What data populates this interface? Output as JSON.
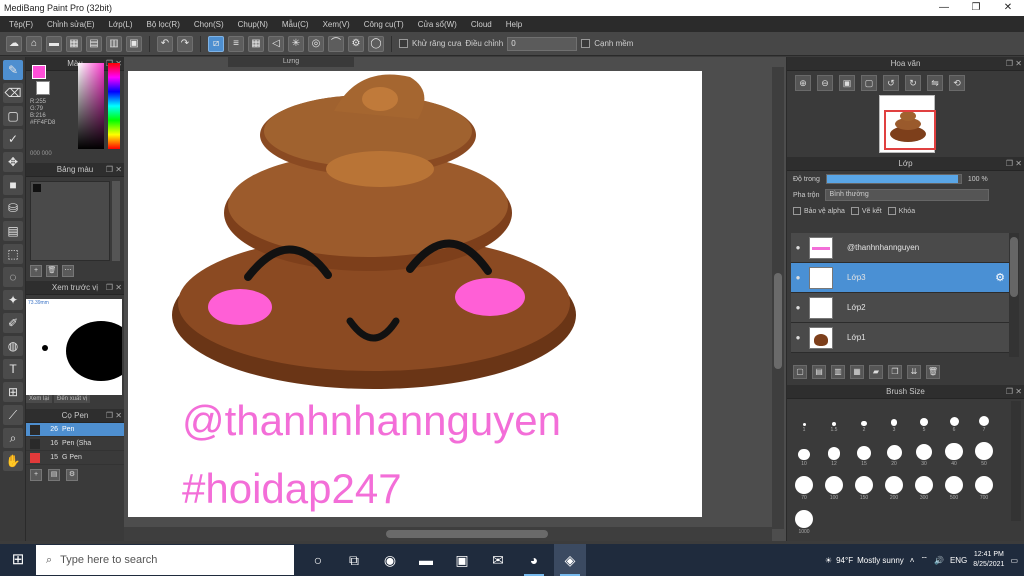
{
  "window": {
    "title": "MediBang Paint Pro (32bit)",
    "controls": [
      "—",
      "❐",
      "✕"
    ]
  },
  "menu": [
    "Tệp(F)",
    "Chỉnh sửa(E)",
    "Lớp(L)",
    "Bộ lọc(R)",
    "Chọn(S)",
    "Chụp(N)",
    "Mẫu(C)",
    "Xem(V)",
    "Công cụ(T)",
    "Cửa sổ(W)",
    "Cloud",
    "Help"
  ],
  "toolbar": {
    "antialias_label": "Khử răng cưa",
    "correction_label": "Điều chỉnh",
    "correction_value": "0",
    "edge_label": "Cạnh mềm"
  },
  "color_panel": {
    "title": "Màu",
    "main_color": "#ff4fd8",
    "sub_color": "#ffffff",
    "values": [
      "R:255",
      "G:79",
      "B:216",
      "#FF4FD8"
    ],
    "footer": "000  000"
  },
  "palette_panel": {
    "title": "Bảng màu"
  },
  "navigator_panel": {
    "title": "Xem trước vị",
    "zoom": "73.39mm",
    "buttons": [
      "Xem lại",
      "Đến xuất vị"
    ]
  },
  "brush_panel": {
    "title": "Cọ Pen",
    "brushes": [
      {
        "size": "26",
        "name": "Pen",
        "color": "#2a2a2a",
        "selected": true
      },
      {
        "size": "16",
        "name": "Pen (Sha",
        "color": "#2a2a2a",
        "selected": false
      },
      {
        "size": "15",
        "name": "G Pen",
        "color": "#e23a3a",
        "selected": false
      }
    ]
  },
  "canvas": {
    "tab_label": "Lưng",
    "watermark_line1": "@thanhnhannguyen",
    "watermark_line2": "#hoidap247",
    "colors": {
      "poop_dark": "#7b3f1c",
      "poop_mid": "#9a5a2c",
      "poop_light": "#b37236",
      "blush": "#ff5fd6",
      "ink": "#111111"
    }
  },
  "preview_panel": {
    "title": "Hoa văn"
  },
  "layer_panel": {
    "title": "Lớp",
    "opacity_label": "Độ trong",
    "opacity_value": "100 %",
    "opacity_fraction": 0.98,
    "blend_label": "Pha trộn",
    "blend_value": "Bình thường",
    "protect_alpha": "Bảo vệ alpha",
    "clipping": "Vẽ kết",
    "lock": "Khóa",
    "layers": [
      {
        "name": "@thanhnhannguyen",
        "selected": false,
        "thumb": "text"
      },
      {
        "name": "Lớp3",
        "selected": true,
        "thumb": "face"
      },
      {
        "name": "Lớp2",
        "selected": false,
        "thumb": "face"
      },
      {
        "name": "Lớp1",
        "selected": false,
        "thumb": "poop"
      }
    ]
  },
  "brush_size_panel": {
    "title": "Brush Size",
    "sizes": [
      "1",
      "1.5",
      "2",
      "3",
      "5",
      "6",
      "7",
      "10",
      "12",
      "15",
      "20",
      "30",
      "40",
      "50",
      "70",
      "100",
      "150",
      "200",
      "300",
      "500",
      "700",
      "1000"
    ]
  },
  "taskbar": {
    "search_placeholder": "Type here to search",
    "weather_temp": "94°F",
    "weather_text": "Mostly sunny",
    "language": "ENG",
    "time": "12:41 PM",
    "date": "8/25/2021"
  }
}
